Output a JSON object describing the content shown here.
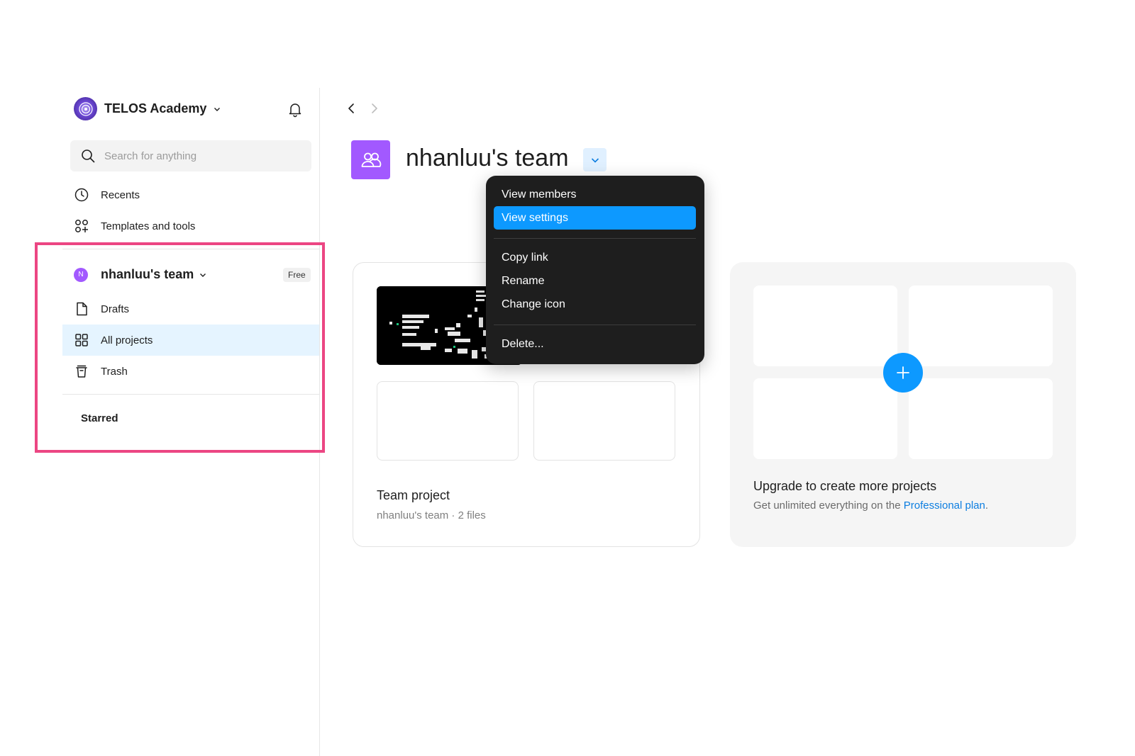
{
  "sidebar": {
    "org_name": "TELOS Academy",
    "search_placeholder": "Search for anything",
    "nav": {
      "recents": "Recents",
      "templates": "Templates and tools"
    },
    "team": {
      "avatar_letter": "N",
      "name": "nhanluu's team",
      "plan_badge": "Free",
      "items": {
        "drafts": "Drafts",
        "all_projects": "All projects",
        "trash": "Trash"
      }
    },
    "starred_heading": "Starred"
  },
  "main": {
    "title": "nhanluu's team",
    "project_card": {
      "title": "Team project",
      "subtitle": "nhanluu's team · 2 files"
    },
    "upgrade_card": {
      "title": "Upgrade to create more projects",
      "subtitle_prefix": "Get unlimited everything on the ",
      "subtitle_link": "Professional plan",
      "subtitle_suffix": "."
    }
  },
  "context_menu": {
    "view_members": "View members",
    "view_settings": "View settings",
    "copy_link": "Copy link",
    "rename": "Rename",
    "change_icon": "Change icon",
    "delete": "Delete..."
  },
  "colors": {
    "accent_blue": "#0d99ff",
    "team_purple": "#a259ff",
    "highlight_pink": "#ec4683",
    "menu_bg": "#1e1e1e"
  }
}
